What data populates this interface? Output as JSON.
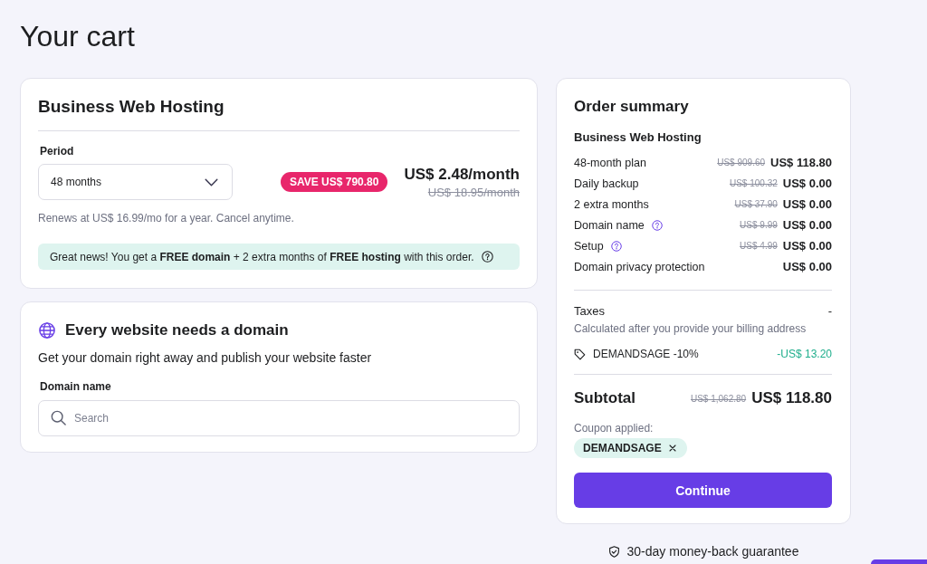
{
  "page": {
    "title": "Your cart"
  },
  "plan_card": {
    "title": "Business Web Hosting",
    "period": {
      "label": "Period",
      "value": "48 months"
    },
    "badge": "SAVE US$ 790.80",
    "price": "US$ 2.48/month",
    "old_price": "US$ 18.95/month",
    "renewal_note": "Renews at US$ 16.99/mo for a year. Cancel anytime.",
    "banner": "Great news! You get a **FREE domain** + 2 extra months of **FREE hosting** with this order."
  },
  "domain_card": {
    "title": "Every website needs a domain",
    "subtitle": "Get your domain right away and publish your website faster",
    "field": {
      "label": "Domain name",
      "placeholder": "Search"
    }
  },
  "order_summary": {
    "title": "Order summary",
    "product": "Business Web Hosting",
    "lines": [
      {
        "label": "48-month plan",
        "old_price": "US$ 909.60",
        "price": "US$ 118.80",
        "info": false
      },
      {
        "label": "Daily backup",
        "old_price": "US$ 100.32",
        "price": "US$ 0.00",
        "info": false
      },
      {
        "label": "2 extra months",
        "old_price": "US$ 37.90",
        "price": "US$ 0.00",
        "info": false
      },
      {
        "label": "Domain name",
        "old_price": "US$ 9.99",
        "price": "US$ 0.00",
        "info": true
      },
      {
        "label": "Setup",
        "old_price": "US$ 4.99",
        "price": "US$ 0.00",
        "info": true
      },
      {
        "label": "Domain privacy protection",
        "price": "US$ 0.00",
        "info": false
      }
    ],
    "taxes": {
      "label": "Taxes",
      "value": "-",
      "note": "Calculated after you provide your billing address"
    },
    "discount": {
      "label": "DEMANDSAGE -10%",
      "amount": "-US$ 13.20"
    },
    "subtotal": {
      "label": "Subtotal",
      "old_price": "US$ 1,062.80",
      "price": "US$ 118.80"
    },
    "coupon": {
      "label": "Coupon applied:",
      "code": "DEMANDSAGE"
    },
    "button": "Continue"
  },
  "guarantee": "30-day money-back guarantee"
}
